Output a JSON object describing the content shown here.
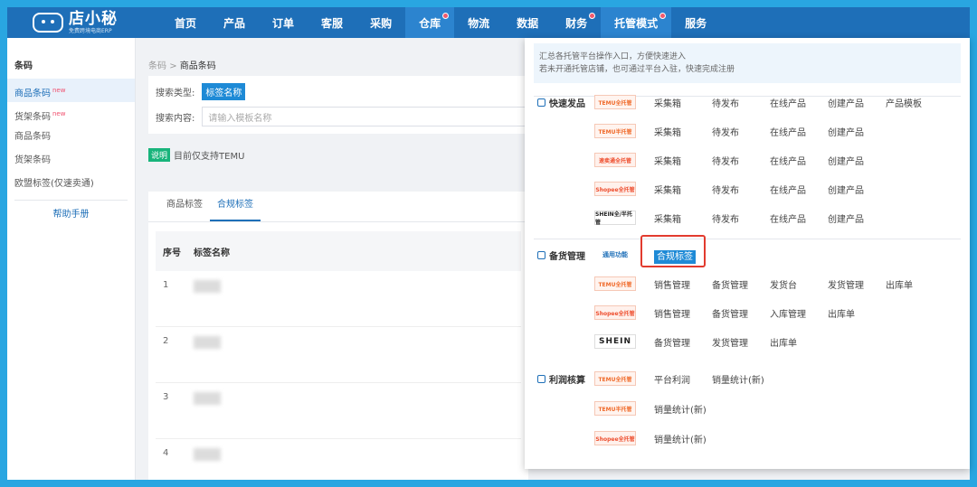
{
  "logo": {
    "name": "店小秘",
    "sub": "免费跨境电商ERP"
  },
  "nav": [
    {
      "label": "首页",
      "dot": false
    },
    {
      "label": "产品",
      "dot": false
    },
    {
      "label": "订单",
      "dot": false
    },
    {
      "label": "客服",
      "dot": false
    },
    {
      "label": "采购",
      "dot": false
    },
    {
      "label": "仓库",
      "dot": true
    },
    {
      "label": "物流",
      "dot": false
    },
    {
      "label": "数据",
      "dot": false
    },
    {
      "label": "财务",
      "dot": true
    },
    {
      "label": "托管模式",
      "dot": true
    },
    {
      "label": "服务",
      "dot": false
    }
  ],
  "sidebar": {
    "title": "条码",
    "items": [
      {
        "label": "商品条码",
        "new": "new"
      },
      {
        "label": "货架条码",
        "new": "new"
      },
      {
        "label": "商品条码",
        "new": ""
      },
      {
        "label": "货架条码",
        "new": ""
      },
      {
        "label": "欧盟标签(仅速卖通)",
        "new": ""
      }
    ],
    "help": "帮助手册"
  },
  "breadcrumb": {
    "parent": "条码",
    "sep": ">",
    "current": "商品条码"
  },
  "search": {
    "type_label": "搜索类型:",
    "type_value": "标签名称",
    "content_label": "搜索内容:",
    "content_placeholder": "请输入模板名称"
  },
  "note": {
    "badge": "说明",
    "text": "目前仅支持TEMU"
  },
  "tabs": [
    "商品标签",
    "合规标签"
  ],
  "table": {
    "headers": [
      "序号",
      "标签名称"
    ],
    "rows": [
      "1",
      "2",
      "3",
      "4"
    ]
  },
  "dropdown": {
    "intro_1": "汇总各托管平台操作入口，方便快速进入",
    "intro_2": "若未开通托管店铺，也可通过平台入驻，快速完成注册",
    "sections": {
      "quick": "快速发品",
      "stock": "备货管理",
      "profit": "利润核算"
    },
    "platforms": {
      "temu_full": "TEMU全托管",
      "temu_half": "TEMU半托管",
      "aliexpress": "速卖通全托管",
      "shopee": "Shopee全托管",
      "shein_half": "SHEIN全/半托管",
      "common": "通用功能",
      "shein": "SHEIN"
    },
    "quick_rows": [
      [
        "采集箱",
        "待发布",
        "在线产品",
        "创建产品",
        "产品模板"
      ],
      [
        "采集箱",
        "待发布",
        "在线产品",
        "创建产品"
      ],
      [
        "采集箱",
        "待发布",
        "在线产品",
        "创建产品"
      ],
      [
        "采集箱",
        "待发布",
        "在线产品",
        "创建产品"
      ],
      [
        "采集箱",
        "待发布",
        "在线产品",
        "创建产品"
      ]
    ],
    "common_link": "合规标签",
    "stock_rows": [
      [
        "销售管理",
        "备货管理",
        "发货台",
        "发货管理",
        "出库单"
      ],
      [
        "销售管理",
        "备货管理",
        "入库管理",
        "出库单"
      ],
      [
        "备货管理",
        "发货管理",
        "出库单"
      ]
    ],
    "profit_rows": [
      [
        "平台利润",
        "销量统计(新)"
      ],
      [
        "销量统计(新)"
      ],
      [
        "销量统计(新)"
      ]
    ]
  }
}
